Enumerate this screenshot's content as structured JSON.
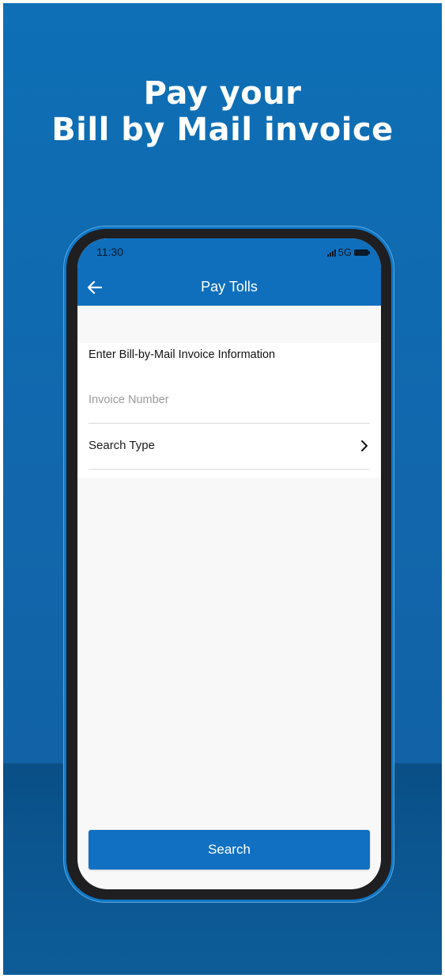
{
  "headline": {
    "line1": "Pay your",
    "line2": "Bill by Mail invoice"
  },
  "status_bar": {
    "time": "11:30",
    "network": "5G"
  },
  "app_bar": {
    "title": "Pay Tolls",
    "back_icon": "back-arrow-icon"
  },
  "form": {
    "section_title": "Enter Bill-by-Mail Invoice Information",
    "invoice_number": {
      "value": "",
      "placeholder": "Invoice Number"
    },
    "search_type": {
      "label": "Search Type",
      "icon": "chevron-right-icon"
    }
  },
  "actions": {
    "search_label": "Search"
  },
  "colors": {
    "background": "#0e6fb6",
    "app_bar": "#0f6fbc",
    "button": "#1170c2"
  }
}
